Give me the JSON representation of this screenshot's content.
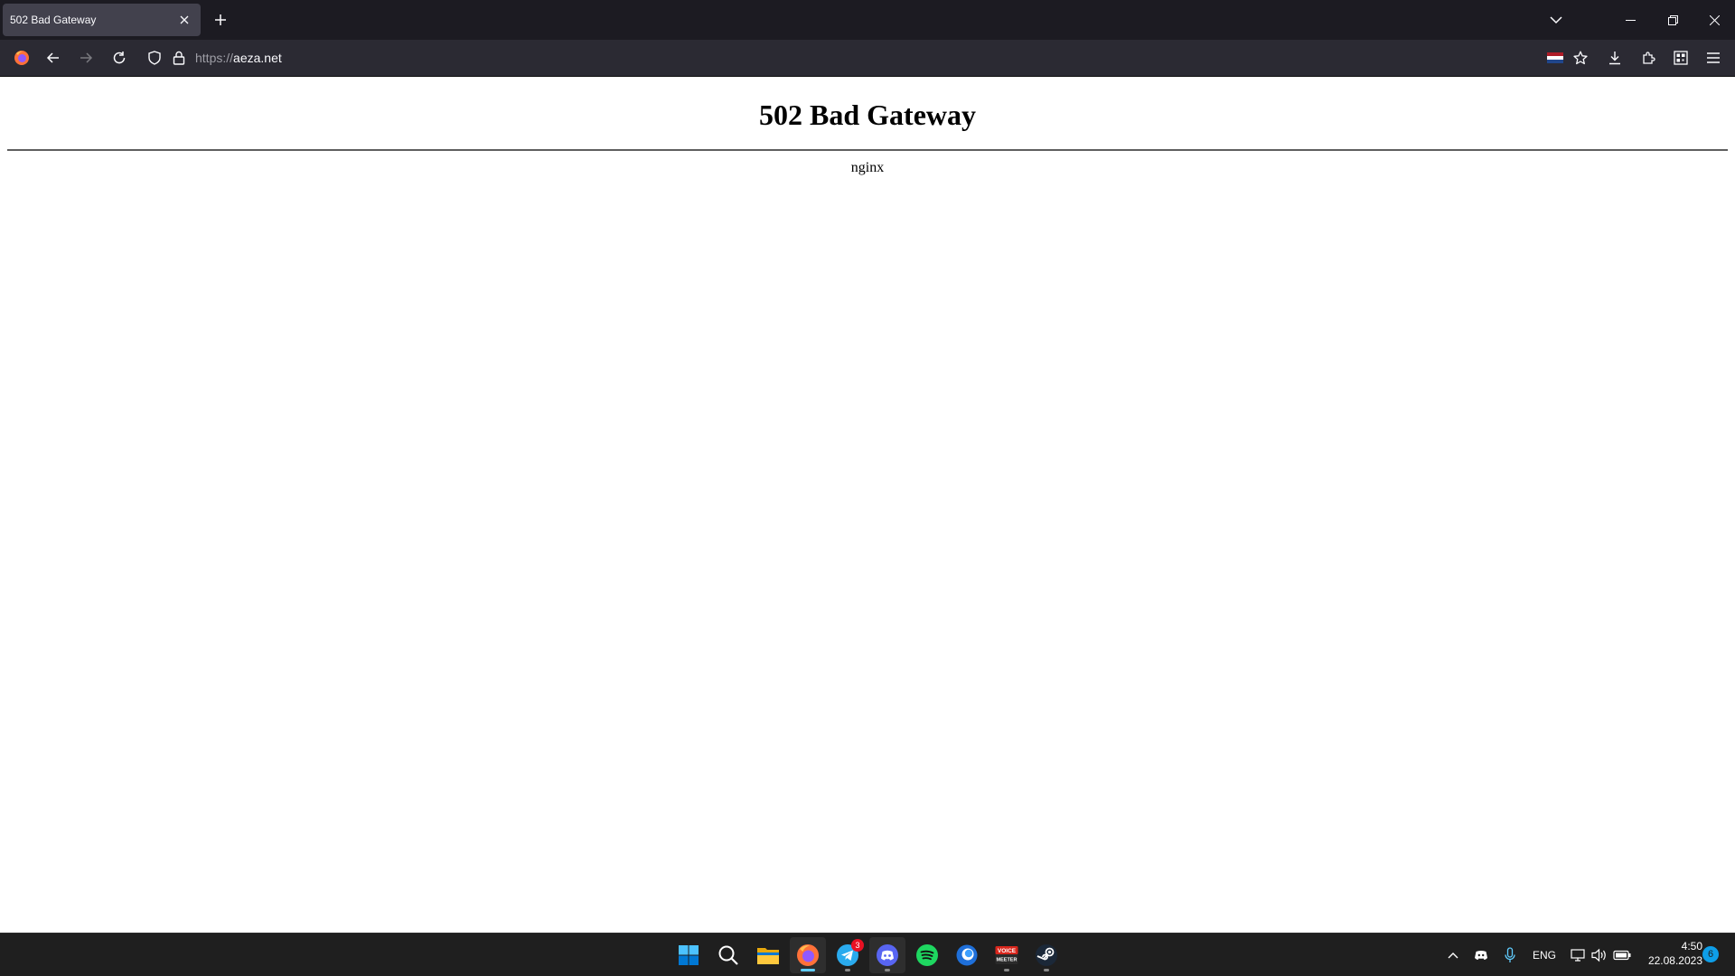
{
  "browser": {
    "tab": {
      "title": "502 Bad Gateway"
    },
    "url": {
      "scheme": "https://",
      "host": "aeza.net"
    }
  },
  "page": {
    "heading": "502 Bad Gateway",
    "server": "nginx"
  },
  "taskbar": {
    "apps": [
      {
        "name": "start",
        "icon": "windows-start-icon"
      },
      {
        "name": "search",
        "icon": "search-icon"
      },
      {
        "name": "file-explorer",
        "icon": "folder-icon"
      },
      {
        "name": "firefox",
        "icon": "firefox-icon",
        "active": true
      },
      {
        "name": "telegram",
        "icon": "telegram-icon",
        "badge": "3"
      },
      {
        "name": "discord",
        "icon": "discord-icon"
      },
      {
        "name": "spotify",
        "icon": "spotify-icon"
      },
      {
        "name": "app",
        "icon": "blue-circle-app-icon"
      },
      {
        "name": "voicemeeter",
        "icon": "voicemeeter-icon",
        "logo_text": "VOICE MEETER"
      },
      {
        "name": "steam",
        "icon": "steam-icon"
      }
    ],
    "tray": {
      "language": "ENG",
      "time": "4:50",
      "date": "22.08.2023",
      "notifications": "6"
    }
  },
  "colors": {
    "tabstrip": "#1c1b22",
    "active_tab": "#42414d",
    "navbar": "#2b2a33",
    "taskbar": "#1f1f1f",
    "accent": "#60cdff"
  }
}
